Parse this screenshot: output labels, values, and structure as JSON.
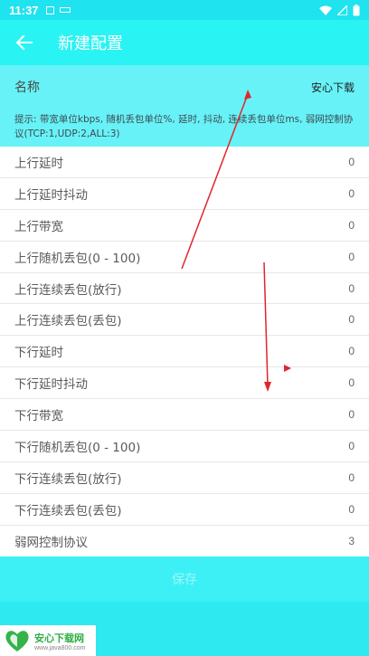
{
  "status_bar": {
    "time": "11:37",
    "icons": [
      "notification-icon",
      "keyboard-icon",
      "wifi-icon",
      "signal-icon",
      "battery-icon"
    ]
  },
  "appbar": {
    "title": "新建配置",
    "back_icon": "arrow-left-icon"
  },
  "name_field": {
    "label": "名称",
    "value": "安心下载"
  },
  "hint": "提示: 带宽单位kbps, 随机丢包单位%, 延时, 抖动, 连续丢包单位ms, 弱网控制协议(TCP:1,UDP:2,ALL:3)",
  "rows": [
    {
      "label": "上行延时",
      "value": "0"
    },
    {
      "label": "上行延时抖动",
      "value": "0"
    },
    {
      "label": "上行带宽",
      "value": "0"
    },
    {
      "label": "上行随机丢包(0 - 100)",
      "value": "0"
    },
    {
      "label": "上行连续丢包(放行)",
      "value": "0"
    },
    {
      "label": "上行连续丢包(丢包)",
      "value": "0"
    },
    {
      "label": "下行延时",
      "value": "0"
    },
    {
      "label": "下行延时抖动",
      "value": "0"
    },
    {
      "label": "下行带宽",
      "value": "0"
    },
    {
      "label": "下行随机丢包(0 - 100)",
      "value": "0"
    },
    {
      "label": "下行连续丢包(放行)",
      "value": "0"
    },
    {
      "label": "下行连续丢包(丢包)",
      "value": "0"
    },
    {
      "label": "弱网控制协议",
      "value": "3"
    }
  ],
  "save_label": "保存",
  "watermark": {
    "title": "安心下载网",
    "url": "www.java800.com"
  },
  "colors": {
    "accent": "#2af3f3",
    "annotation_red": "#e0262c"
  }
}
